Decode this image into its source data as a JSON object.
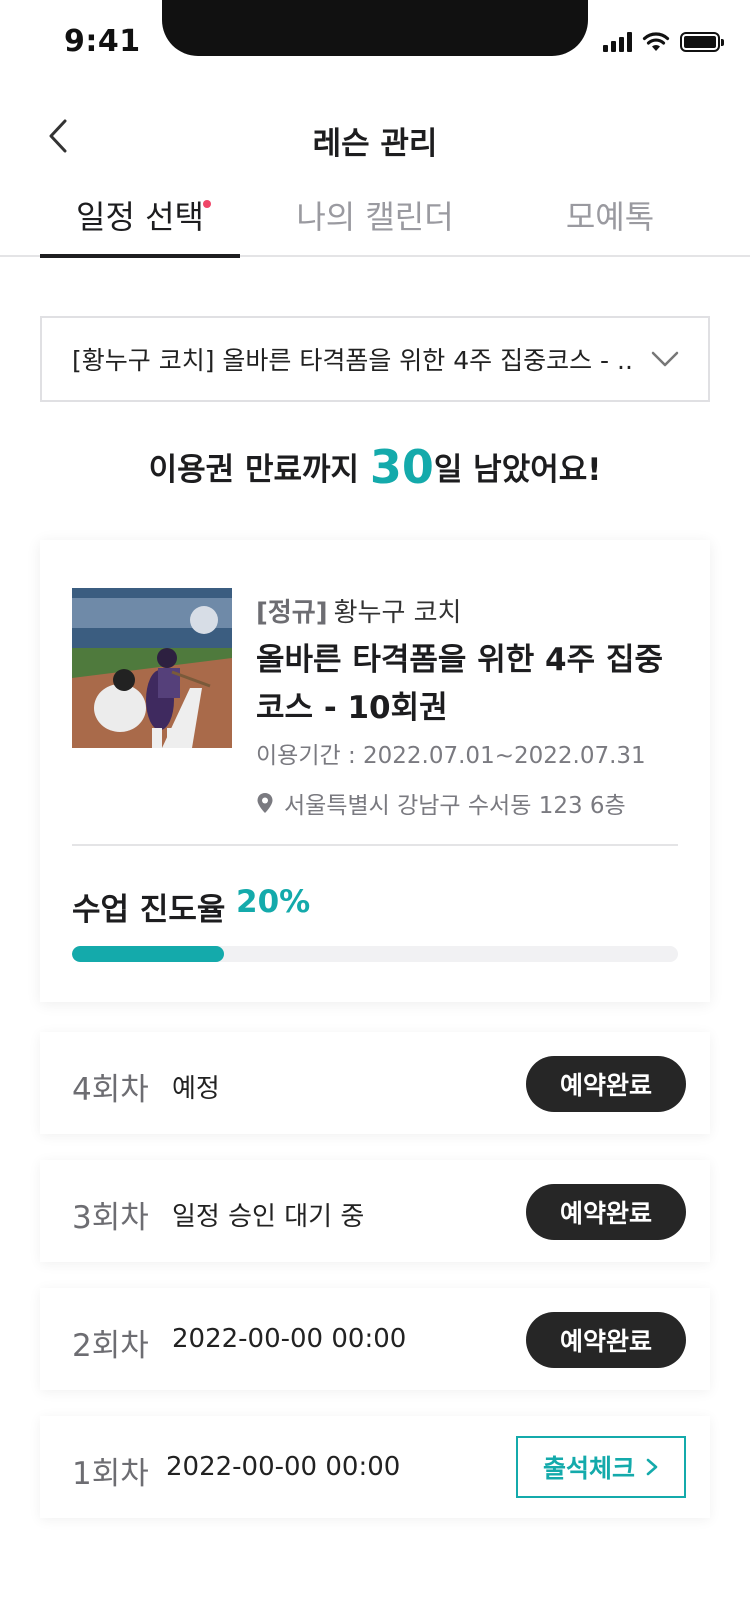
{
  "status_bar": {
    "time": "9:41"
  },
  "header": {
    "title": "레슨 관리"
  },
  "tabs": [
    {
      "label": "일정 선택",
      "active": true,
      "has_dot": true
    },
    {
      "label": "나의 캘린더",
      "active": false
    },
    {
      "label": "모예톡",
      "active": false
    }
  ],
  "course_select": {
    "value": "[황누구 코치] 올바른 타격폼을 위한 4주 집중코스 - .."
  },
  "remaining": {
    "prefix": "이용권 만료까지 ",
    "days": "30",
    "suffix": "일 남았어요!"
  },
  "course_card": {
    "tag": "[정규]",
    "coach": "황누구 코치",
    "title": "올바른 타격폼을 위한 4주 집중코스 - 10회권",
    "period": "이용기간 : 2022.07.01~2022.07.31",
    "location": "서울특별시 강남구 수서동 123 6층",
    "progress_label": "수업 진도율",
    "progress_value": "20%",
    "progress_fraction": 0.25
  },
  "sessions": [
    {
      "num": "4회차",
      "text": "예정",
      "action": "예약완료"
    },
    {
      "num": "3회차",
      "text": "일정 승인 대기 중",
      "action": "예약완료"
    },
    {
      "num": "2회차",
      "text": "2022-00-00 00:00",
      "action": "예약완료"
    },
    {
      "num": "1회차",
      "text": "2022-00-00 00:00",
      "action": "출석체크"
    }
  ],
  "colors": {
    "accent": "#14aaab",
    "dark_pill": "#262626",
    "dot": "#f04668"
  }
}
